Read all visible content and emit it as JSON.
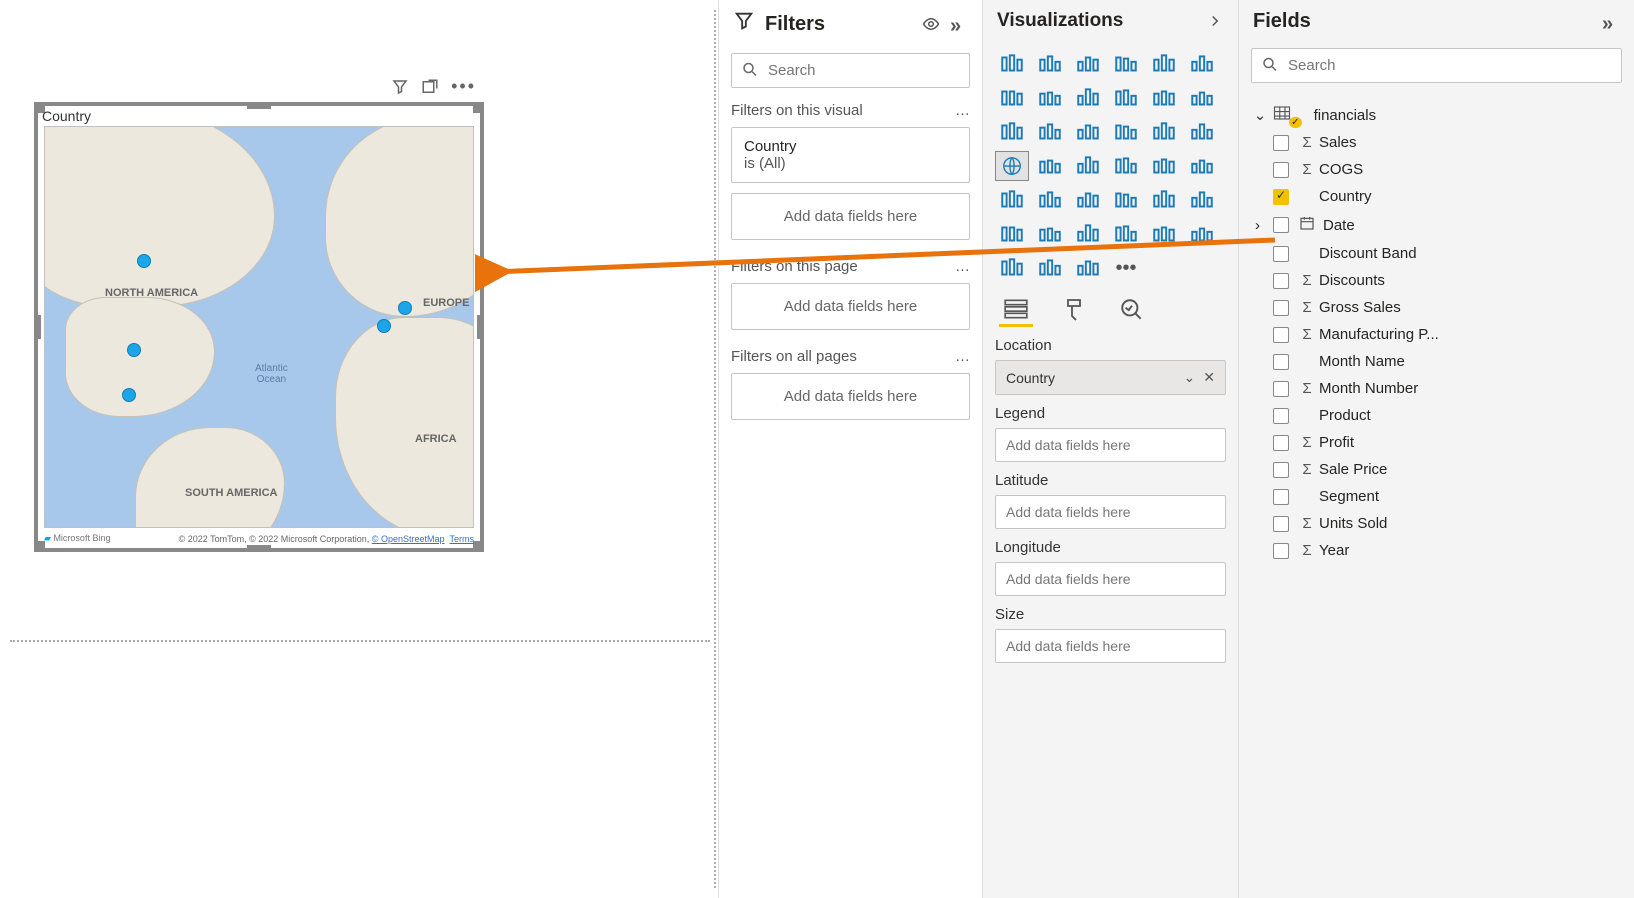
{
  "visual": {
    "title": "Country",
    "labels": {
      "na": "NORTH AMERICA",
      "sa": "SOUTH AMERICA",
      "eu": "EUROPE",
      "af": "AFRICA",
      "ocean": "Atlantic\nOcean"
    },
    "attribution": {
      "bing": "Microsoft Bing",
      "text": "© 2022 TomTom, © 2022 Microsoft Corporation, ",
      "osm": "© OpenStreetMap",
      "terms": "Terms"
    }
  },
  "filters": {
    "title": "Filters",
    "search_placeholder": "Search",
    "visual_label": "Filters on this visual",
    "visual_card": {
      "field": "Country",
      "summary": "is (All)"
    },
    "add_placeholder": "Add data fields here",
    "page_label": "Filters on this page",
    "all_label": "Filters on all pages"
  },
  "viz": {
    "title": "Visualizations",
    "wells": {
      "location": {
        "label": "Location",
        "value": "Country"
      },
      "legend": {
        "label": "Legend",
        "placeholder": "Add data fields here"
      },
      "latitude": {
        "label": "Latitude",
        "placeholder": "Add data fields here"
      },
      "longitude": {
        "label": "Longitude",
        "placeholder": "Add data fields here"
      },
      "size": {
        "label": "Size",
        "placeholder": "Add data fields here"
      }
    }
  },
  "fields": {
    "title": "Fields",
    "search_placeholder": "Search",
    "table": "financials",
    "items": [
      {
        "name": "Sales",
        "sigma": true,
        "checked": false
      },
      {
        "name": "COGS",
        "sigma": true,
        "checked": false
      },
      {
        "name": "Country",
        "sigma": false,
        "checked": true
      },
      {
        "name": "Date",
        "sigma": false,
        "checked": false,
        "date": true,
        "expandable": true
      },
      {
        "name": "Discount Band",
        "sigma": false,
        "checked": false
      },
      {
        "name": "Discounts",
        "sigma": true,
        "checked": false
      },
      {
        "name": "Gross Sales",
        "sigma": true,
        "checked": false
      },
      {
        "name": "Manufacturing P...",
        "sigma": true,
        "checked": false
      },
      {
        "name": "Month Name",
        "sigma": false,
        "checked": false
      },
      {
        "name": "Month Number",
        "sigma": true,
        "checked": false
      },
      {
        "name": "Product",
        "sigma": false,
        "checked": false
      },
      {
        "name": "Profit",
        "sigma": true,
        "checked": false
      },
      {
        "name": "Sale Price",
        "sigma": true,
        "checked": false
      },
      {
        "name": "Segment",
        "sigma": false,
        "checked": false
      },
      {
        "name": "Units Sold",
        "sigma": true,
        "checked": false
      },
      {
        "name": "Year",
        "sigma": true,
        "checked": false
      }
    ]
  }
}
